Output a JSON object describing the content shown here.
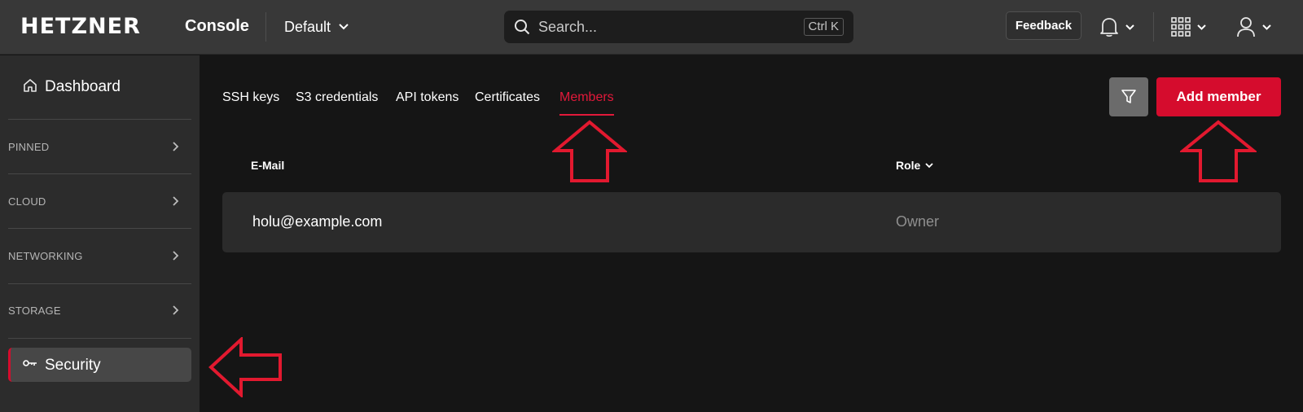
{
  "header": {
    "logo": "HETZNER",
    "app_name": "Console",
    "project": "Default",
    "search": {
      "placeholder": "Search...",
      "shortcut": "Ctrl K"
    },
    "feedback_label": "Feedback",
    "icons": [
      "bell-icon",
      "apps-grid-icon",
      "user-icon"
    ]
  },
  "sidebar": {
    "dashboard_label": "Dashboard",
    "sections": [
      {
        "label": "PINNED"
      },
      {
        "label": "CLOUD"
      },
      {
        "label": "NETWORKING"
      },
      {
        "label": "STORAGE"
      }
    ],
    "security_label": "Security"
  },
  "main": {
    "tabs": [
      {
        "label": "SSH keys"
      },
      {
        "label": "S3 credentials"
      },
      {
        "label": "API tokens"
      },
      {
        "label": "Certificates"
      },
      {
        "label": "Members",
        "active": true
      }
    ],
    "add_button_label": "Add member",
    "table": {
      "columns": [
        "E-Mail",
        "Role"
      ],
      "rows": [
        {
          "email": "holu@example.com",
          "role": "Owner"
        }
      ]
    }
  },
  "colors": {
    "accent": "#d50c2d",
    "annotation_arrow": "#e2192f",
    "topbar": "#383838",
    "sidebar": "#2c2c2c",
    "background": "#151515"
  }
}
